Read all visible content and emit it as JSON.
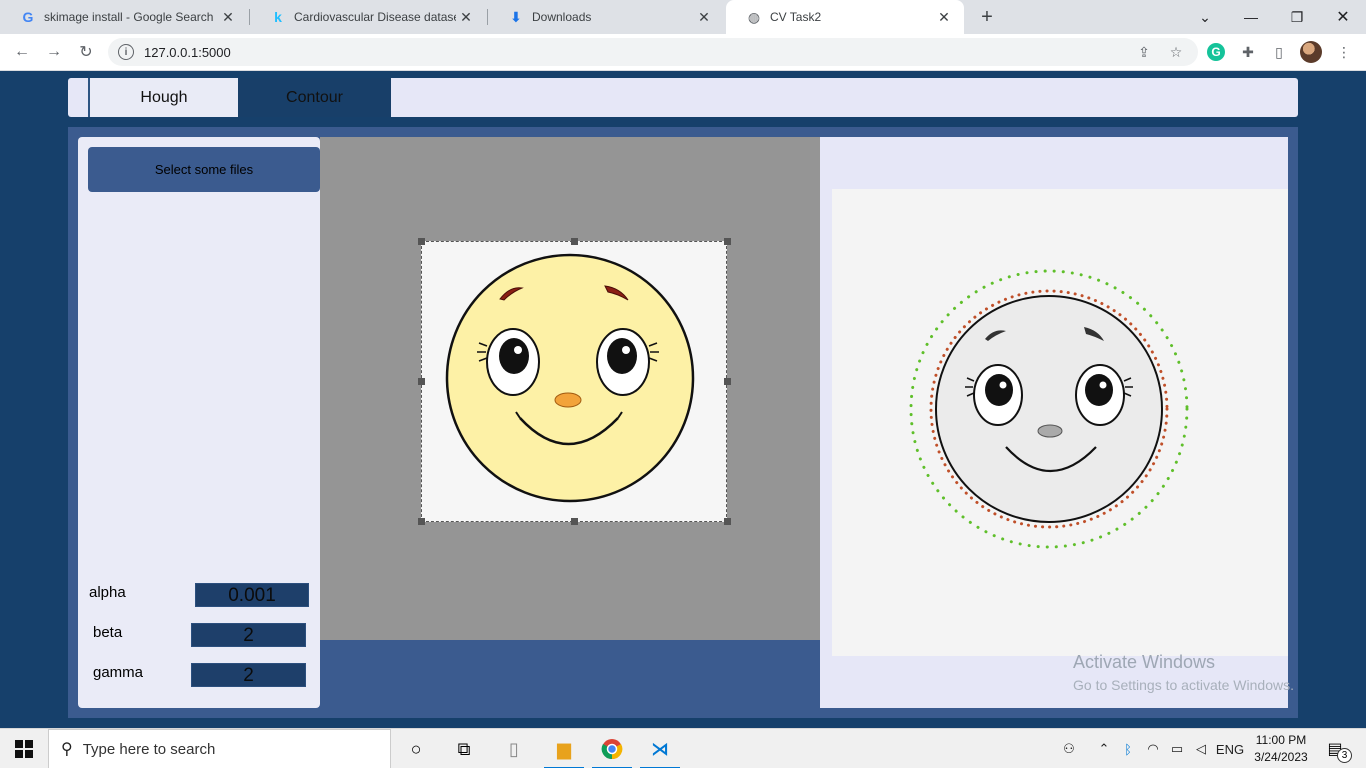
{
  "browser": {
    "tabs": [
      {
        "title": "skimage install - Google Search",
        "icon": "google-icon"
      },
      {
        "title": "Cardiovascular Disease dataset | ",
        "icon": "kaggle-icon"
      },
      {
        "title": "Downloads",
        "icon": "download-icon"
      },
      {
        "title": "CV Task2",
        "icon": "globe-icon",
        "active": true
      }
    ],
    "url": "127.0.0.1:5000"
  },
  "app": {
    "tabs": [
      {
        "label": "Hough"
      },
      {
        "label": "Contour",
        "active": true
      }
    ],
    "select_button": "Select some files",
    "params": [
      {
        "label": "alpha",
        "value": "0.001"
      },
      {
        "label": "beta",
        "value": "2"
      },
      {
        "label": "gamma",
        "value": "2"
      }
    ]
  },
  "watermark": {
    "line1": "Activate Windows",
    "line2": "Go to Settings to activate Windows."
  },
  "taskbar": {
    "search_placeholder": "Type here to search",
    "language": "ENG",
    "time": "11:00 PM",
    "date": "3/24/2023",
    "notification_count": "3"
  },
  "colors": {
    "page_bg": "#16406b",
    "panel_bg": "#3b5b8f",
    "light_panel": "#eaebf7",
    "face_yellow": "#fdf1a6",
    "contour_red": "#c0502a",
    "contour_green": "#5fbf2a"
  }
}
